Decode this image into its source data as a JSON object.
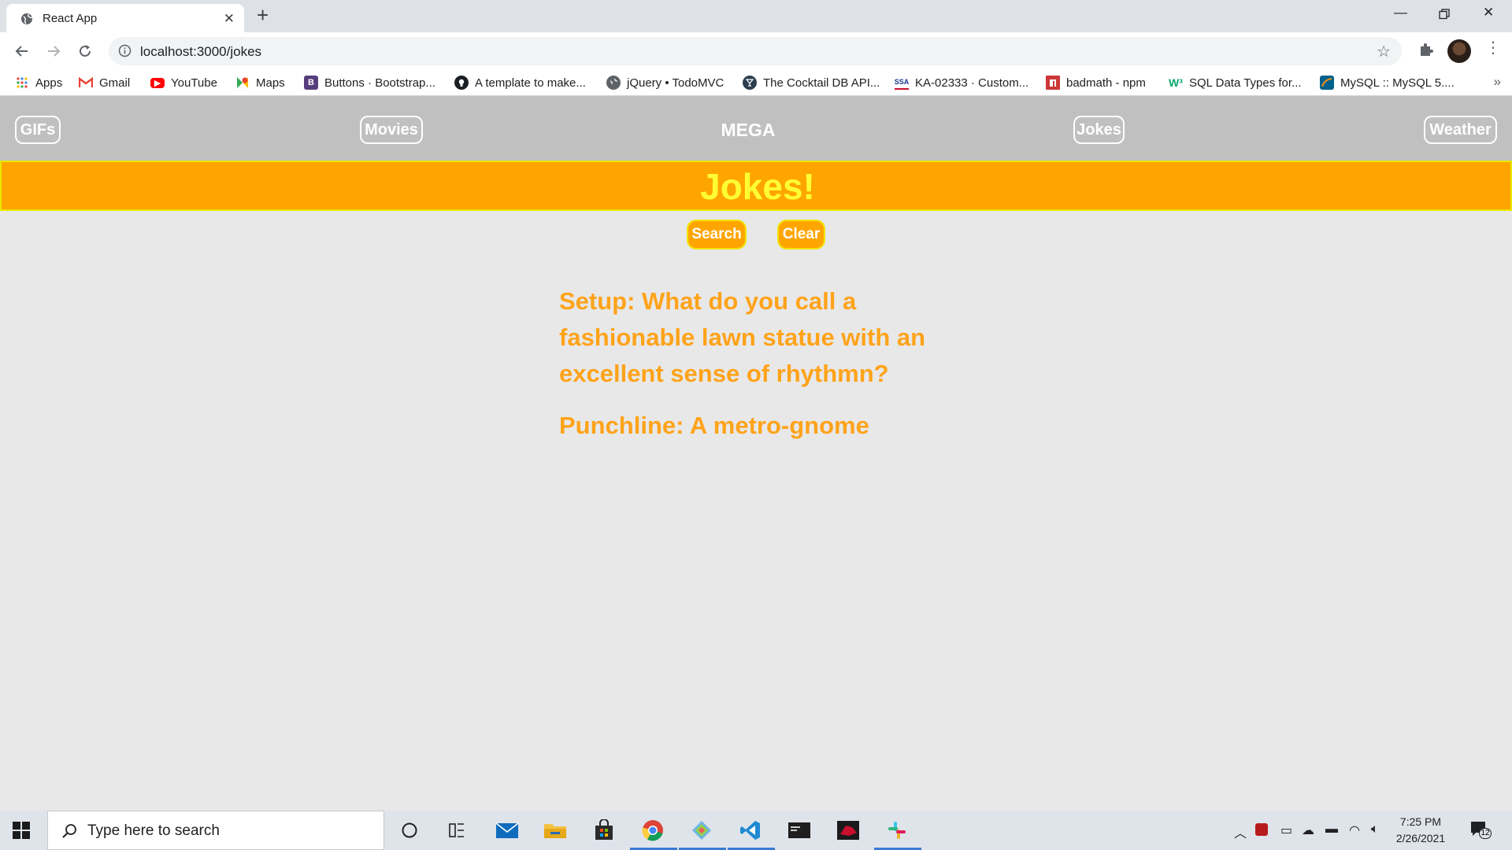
{
  "browser": {
    "tab_title": "React App",
    "url": "localhost:3000/jokes",
    "bookmarks": [
      {
        "label": "Apps",
        "icon": "apps-grid-icon"
      },
      {
        "label": "Gmail",
        "icon": "gmail-icon"
      },
      {
        "label": "YouTube",
        "icon": "youtube-icon"
      },
      {
        "label": "Maps",
        "icon": "maps-icon"
      },
      {
        "label": "Buttons · Bootstrap...",
        "icon": "bootstrap-icon"
      },
      {
        "label": "A template to make...",
        "icon": "github-icon"
      },
      {
        "label": "jQuery • TodoMVC",
        "icon": "globe-icon"
      },
      {
        "label": "The Cocktail DB API...",
        "icon": "cocktaildb-icon"
      },
      {
        "label": "KA-02333 · Custom...",
        "icon": "ssa-icon"
      },
      {
        "label": "badmath - npm",
        "icon": "npm-icon"
      },
      {
        "label": "SQL Data Types for...",
        "icon": "w3schools-icon"
      },
      {
        "label": "MySQL :: MySQL 5....",
        "icon": "mysql-icon"
      }
    ],
    "more_bookmarks": "»"
  },
  "app": {
    "nav": {
      "gifs": "GIFs",
      "movies": "Movies",
      "brand": "MEGA",
      "jokes": "Jokes",
      "weather": "Weather"
    },
    "banner_title": "Jokes!",
    "search_button": "Search",
    "clear_button": "Clear",
    "joke": {
      "setup": "Setup: What do you call a fashionable lawn statue with an excellent sense of rhythmn?",
      "punchline": "Punchline: A metro-gnome"
    },
    "colors": {
      "nav_bg": "#c0c0c0",
      "accent_orange": "#ffa500",
      "title_yellow": "#ffff33",
      "page_bg": "#e8e8e8"
    }
  },
  "taskbar": {
    "search_placeholder": "Type here to search",
    "time": "7:25 PM",
    "date": "2/26/2021",
    "notification_count": "12"
  }
}
